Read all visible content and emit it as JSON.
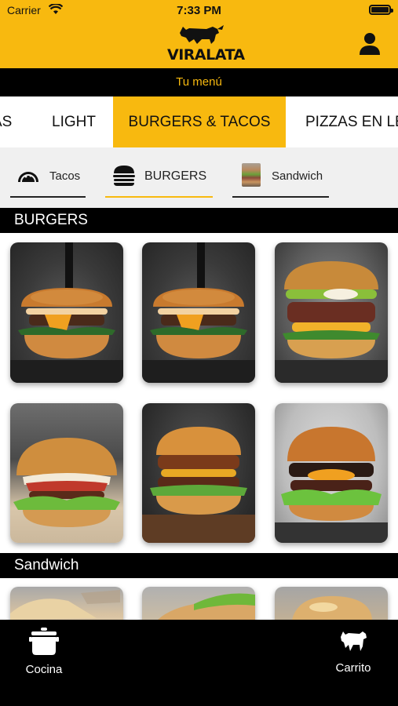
{
  "status_bar": {
    "carrier": "Carrier",
    "time": "7:33 PM"
  },
  "header": {
    "logo_text": "VIRALATA"
  },
  "menu_bar": {
    "title": "Tu menú"
  },
  "category_tabs": [
    {
      "label": "AS"
    },
    {
      "label": "LIGHT"
    },
    {
      "label": "BURGERS & TACOS",
      "active": true
    },
    {
      "label": "PIZZAS EN LE"
    }
  ],
  "sub_tabs": [
    {
      "label": "Tacos",
      "icon": "taco-icon"
    },
    {
      "label": "BURGERS",
      "icon": "burger-icon",
      "active": true
    },
    {
      "label": "Sandwich",
      "icon": "sandwich-thumbnail"
    }
  ],
  "sections": [
    {
      "title": "BURGERS"
    },
    {
      "title": "Sandwich"
    }
  ],
  "bottom_nav": {
    "kitchen_label": "Cocina",
    "cart_label": "Carrito"
  },
  "colors": {
    "accent": "#f8b90f",
    "dark": "#000000",
    "surface": "#f0f0f0"
  }
}
